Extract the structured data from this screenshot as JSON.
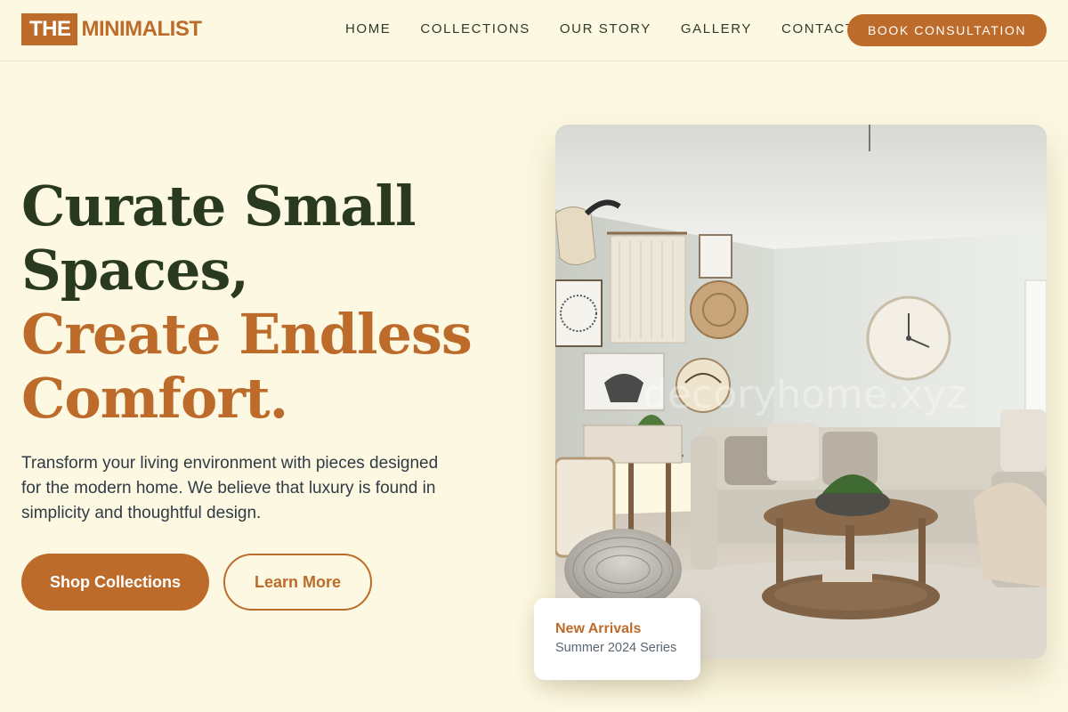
{
  "brand": {
    "box_text": "THE",
    "text": "MINIMALIST"
  },
  "nav": {
    "items": [
      {
        "label": "HOME"
      },
      {
        "label": "COLLECTIONS"
      },
      {
        "label": "OUR STORY"
      },
      {
        "label": "GALLERY"
      },
      {
        "label": "CONTACT"
      }
    ],
    "cta": "BOOK CONSULTATION"
  },
  "hero": {
    "headline_line1": "Curate Small",
    "headline_line2": "Spaces,",
    "headline_line3": "Create Endless",
    "headline_line4": "Comfort.",
    "lead": "Transform your living environment with pieces designed for the modern home. We believe that luxury is found in simplicity and thoughtful design.",
    "primary_button": "Shop Collections",
    "secondary_button": "Learn More",
    "image_watermark": "decoryhome.xyz"
  },
  "badge": {
    "title": "New Arrivals",
    "subtitle": "Summer 2024 Series"
  },
  "colors": {
    "background": "#fdf8e1",
    "accent": "#bd6b2b",
    "headline_dark": "#2a3a20",
    "body_text": "#2f3b45"
  }
}
